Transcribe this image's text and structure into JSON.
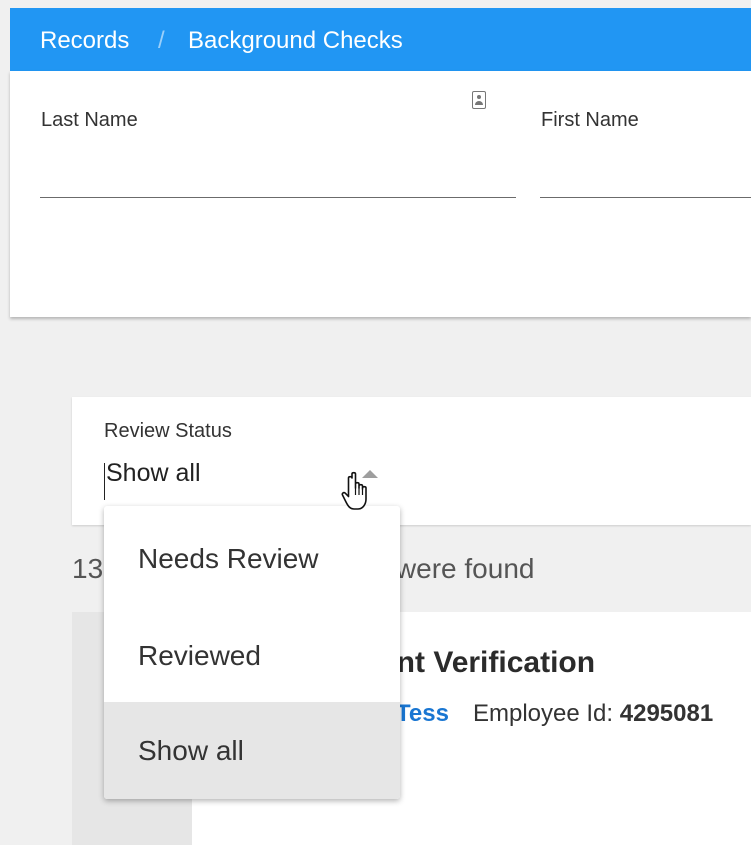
{
  "breadcrumb": {
    "items": [
      "Records",
      "Background Checks"
    ],
    "separator": "/"
  },
  "filters": {
    "last_name": {
      "label": "Last Name",
      "value": ""
    },
    "first_name": {
      "label": "First Name",
      "value": ""
    }
  },
  "review_status": {
    "label": "Review Status",
    "selected": "Show all",
    "options": [
      "Needs Review",
      "Reviewed",
      "Show all"
    ]
  },
  "results": {
    "count_prefix": "13",
    "count_suffix": "s were found"
  },
  "result_card": {
    "title": "ent Verification",
    "name": "Tess",
    "employee_id_label": "Employee Id:",
    "employee_id_value": "4295081"
  },
  "colors": {
    "accent": "#2196f3",
    "link": "#1976d2",
    "selected_option": "#e6e6e6"
  },
  "icons": {
    "contact": "contact-card-icon",
    "dropdown_arrow": "triangle-up-icon",
    "cursor": "hand-pointer-icon"
  }
}
